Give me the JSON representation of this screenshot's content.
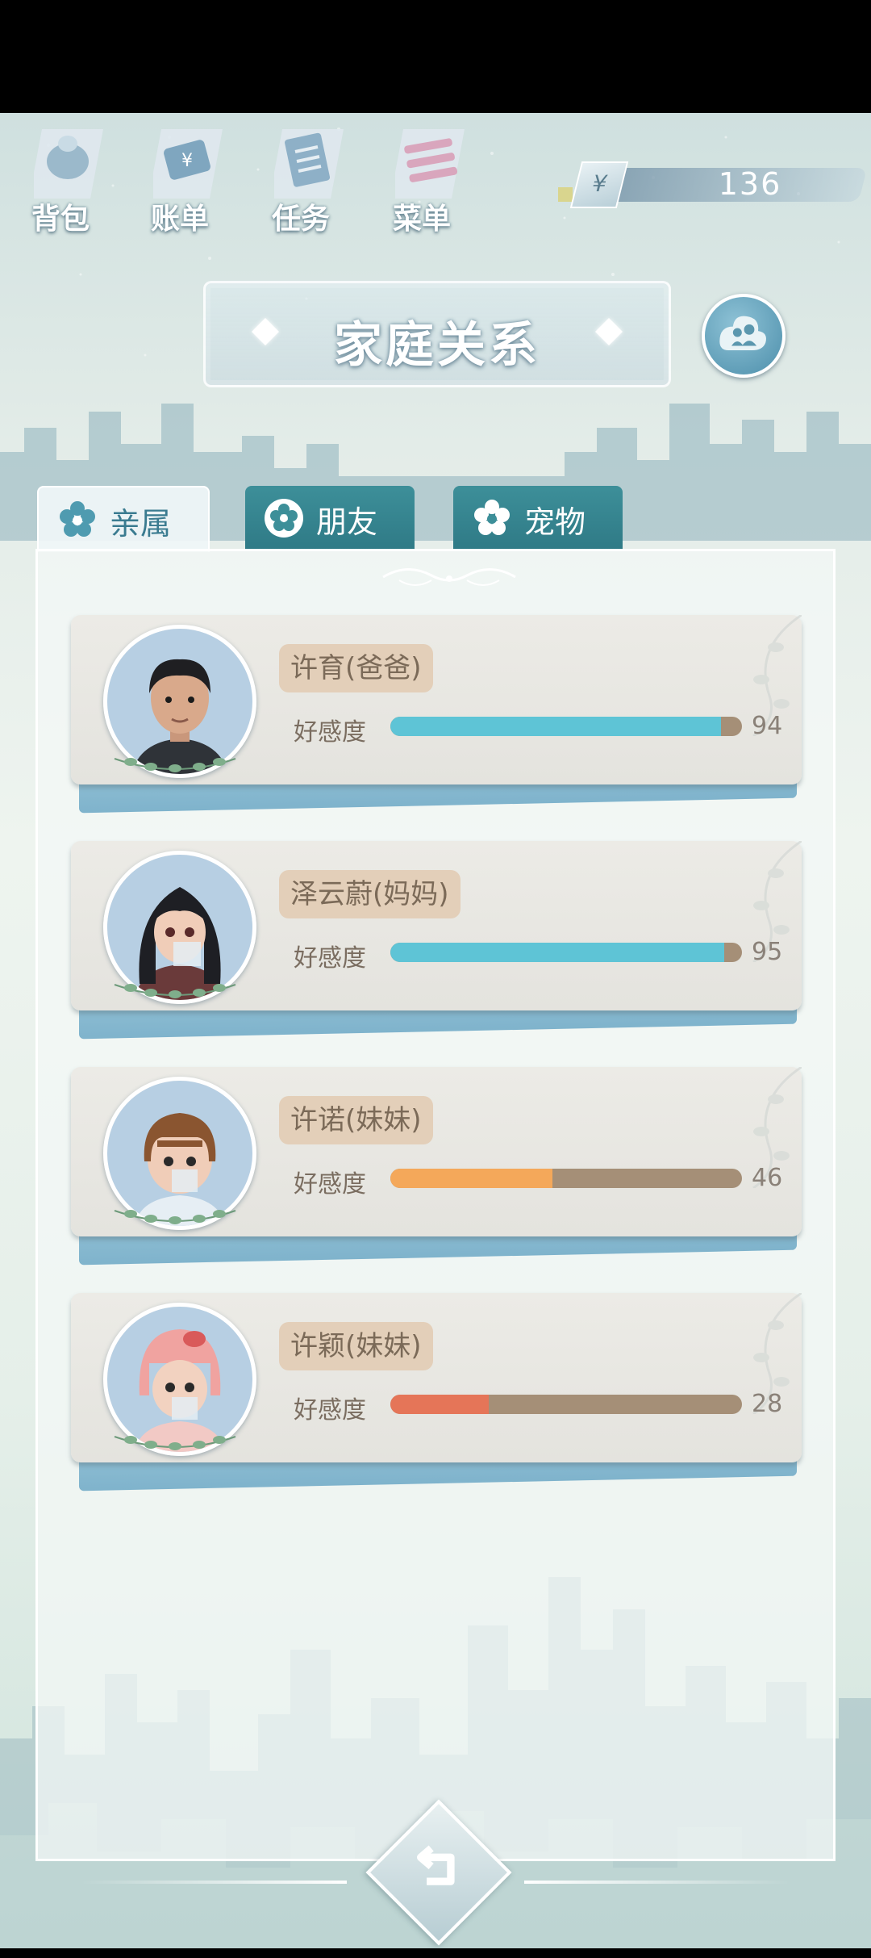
{
  "topbar": {
    "buttons": [
      {
        "label": "背包",
        "icon": "bag-icon"
      },
      {
        "label": "账单",
        "icon": "bill-icon"
      },
      {
        "label": "任务",
        "icon": "task-icon"
      },
      {
        "label": "菜单",
        "icon": "menu-icon"
      }
    ],
    "currency": {
      "symbol": "¥",
      "value": "136"
    }
  },
  "title": "家庭关系",
  "tabs": [
    {
      "label": "亲属",
      "active": true
    },
    {
      "label": "朋友",
      "active": false
    },
    {
      "label": "宠物",
      "active": false
    }
  ],
  "affection_label": "好感度",
  "members": [
    {
      "name": "许育(爸爸)",
      "affection": "94",
      "percent": 94,
      "color": "#5ec4d6"
    },
    {
      "name": "泽云蔚(妈妈)",
      "affection": "95",
      "percent": 95,
      "color": "#5ec4d6"
    },
    {
      "name": "许诺(妹妹)",
      "affection": "46",
      "percent": 46,
      "color": "#f4a85a"
    },
    {
      "name": "许颖(妹妹)",
      "affection": "28",
      "percent": 28,
      "color": "#e57558"
    }
  ]
}
